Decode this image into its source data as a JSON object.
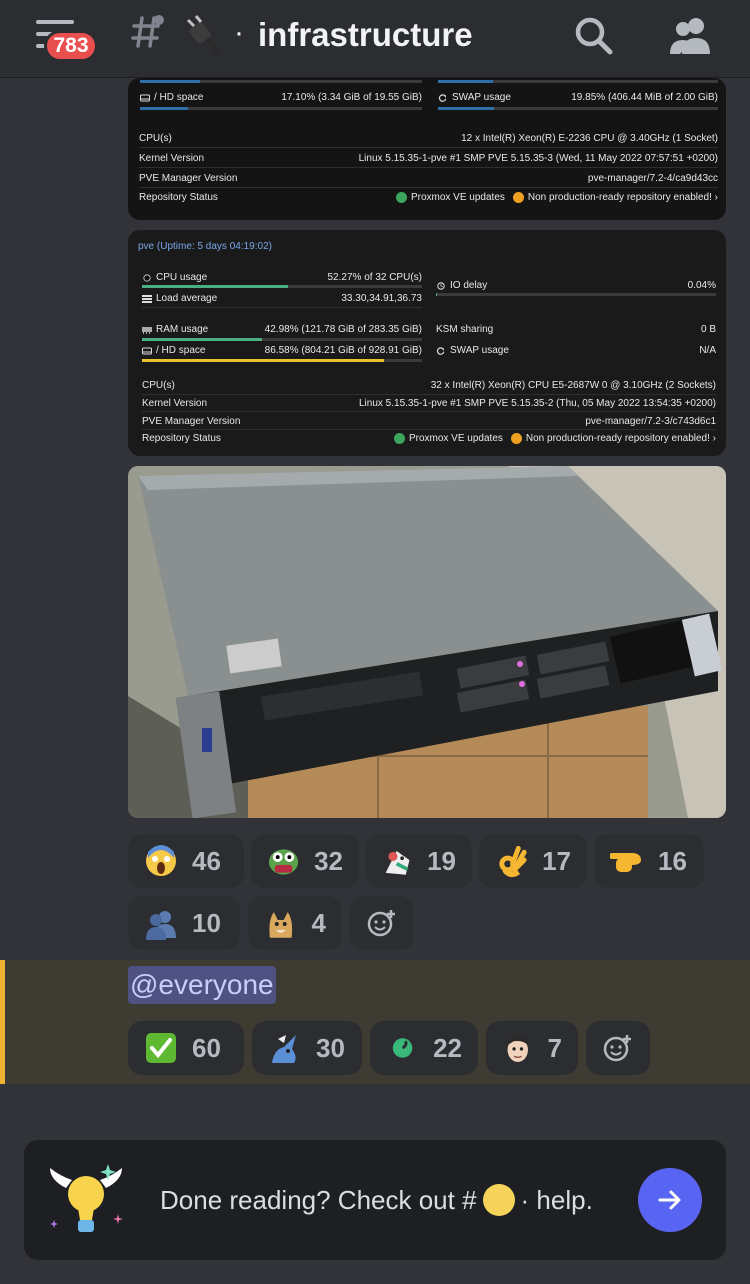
{
  "header": {
    "unread_badge": "783",
    "channel_separator": "·",
    "channel_name": "infrastructure"
  },
  "card1": {
    "hd_label": "/ HD space",
    "hd_value": "17.10% (3.34 GiB of 19.55 GiB)",
    "hd_fraction": 0.171,
    "swap_label": "SWAP usage",
    "swap_value": "19.85% (406.44 MiB of 2.00 GiB)",
    "swap_fraction": 0.1985,
    "info": [
      {
        "key": "CPU(s)",
        "value": "12 x Intel(R) Xeon(R) E-2236 CPU @ 3.40GHz (1 Socket)"
      },
      {
        "key": "Kernel Version",
        "value": "Linux 5.15.35-1-pve #1 SMP PVE 5.15.35-3 (Wed, 11 May 2022 07:57:51 +0200)"
      },
      {
        "key": "PVE Manager Version",
        "value": "pve-manager/7.2-4/ca9d43cc"
      }
    ],
    "repo_label": "Repository Status",
    "repo_ok": "Proxmox VE updates",
    "repo_warn": "Non production-ready repository enabled!"
  },
  "card2": {
    "title": "pve (Uptime: 5 days 04:19:02)",
    "cpu_label": "CPU usage",
    "cpu_value": "52.27% of 32 CPU(s)",
    "cpu_fraction": 0.5227,
    "io_label": "IO delay",
    "io_value": "0.04%",
    "load_label": "Load average",
    "load_value": "33.30,34.91,36.73",
    "ram_label": "RAM usage",
    "ram_value": "42.98% (121.78 GiB of 283.35 GiB)",
    "ram_fraction": 0.4298,
    "ksm_label": "KSM sharing",
    "ksm_value": "0 B",
    "hd_label": "/ HD space",
    "hd_value": "86.58% (804.21 GiB of 928.91 GiB)",
    "hd_fraction": 0.8658,
    "swap_label": "SWAP usage",
    "swap_value": "N/A",
    "info": [
      {
        "key": "CPU(s)",
        "value": "32 x Intel(R) Xeon(R) CPU E5-2687W 0 @ 3.10GHz (2 Sockets)"
      },
      {
        "key": "Kernel Version",
        "value": "Linux 5.15.35-1-pve #1 SMP PVE 5.15.35-2 (Thu, 05 May 2022 13:54:35 +0200)"
      },
      {
        "key": "PVE Manager Version",
        "value": "pve-manager/7.2-3/c743d6c1"
      }
    ],
    "repo_label": "Repository Status",
    "repo_ok": "Proxmox VE updates",
    "repo_warn": "Non production-ready repository enabled!"
  },
  "reactions_row1": [
    {
      "icon": "screaming-face",
      "count": "46"
    },
    {
      "icon": "pepe-frog",
      "count": "32"
    },
    {
      "icon": "cartoon-character",
      "count": "19"
    },
    {
      "icon": "ok-hand",
      "count": "17"
    },
    {
      "icon": "pointing-hand",
      "count": "16"
    }
  ],
  "reactions_row2": [
    {
      "icon": "busts-silhouette",
      "count": "10"
    },
    {
      "icon": "doge",
      "count": "4"
    }
  ],
  "mention": "@everyone",
  "reactions_row3": [
    {
      "icon": "check-mark-button",
      "count": "60"
    },
    {
      "icon": "bird-drawing",
      "count": "30"
    },
    {
      "icon": "green-spiral",
      "count": "22"
    },
    {
      "icon": "face-avatar",
      "count": "7"
    }
  ],
  "banner": {
    "text_before": "Done reading? Check out #",
    "text_after": "· help."
  },
  "colors": {
    "background": "#313338",
    "topbar": "#2b2d31",
    "badge": "#e94f4f",
    "accent": "#5865f2",
    "highlight_border": "#f0b232",
    "bar_green": "#4caf7f",
    "bar_blue": "#2f6fa8",
    "bar_yellow": "#e8c330"
  }
}
